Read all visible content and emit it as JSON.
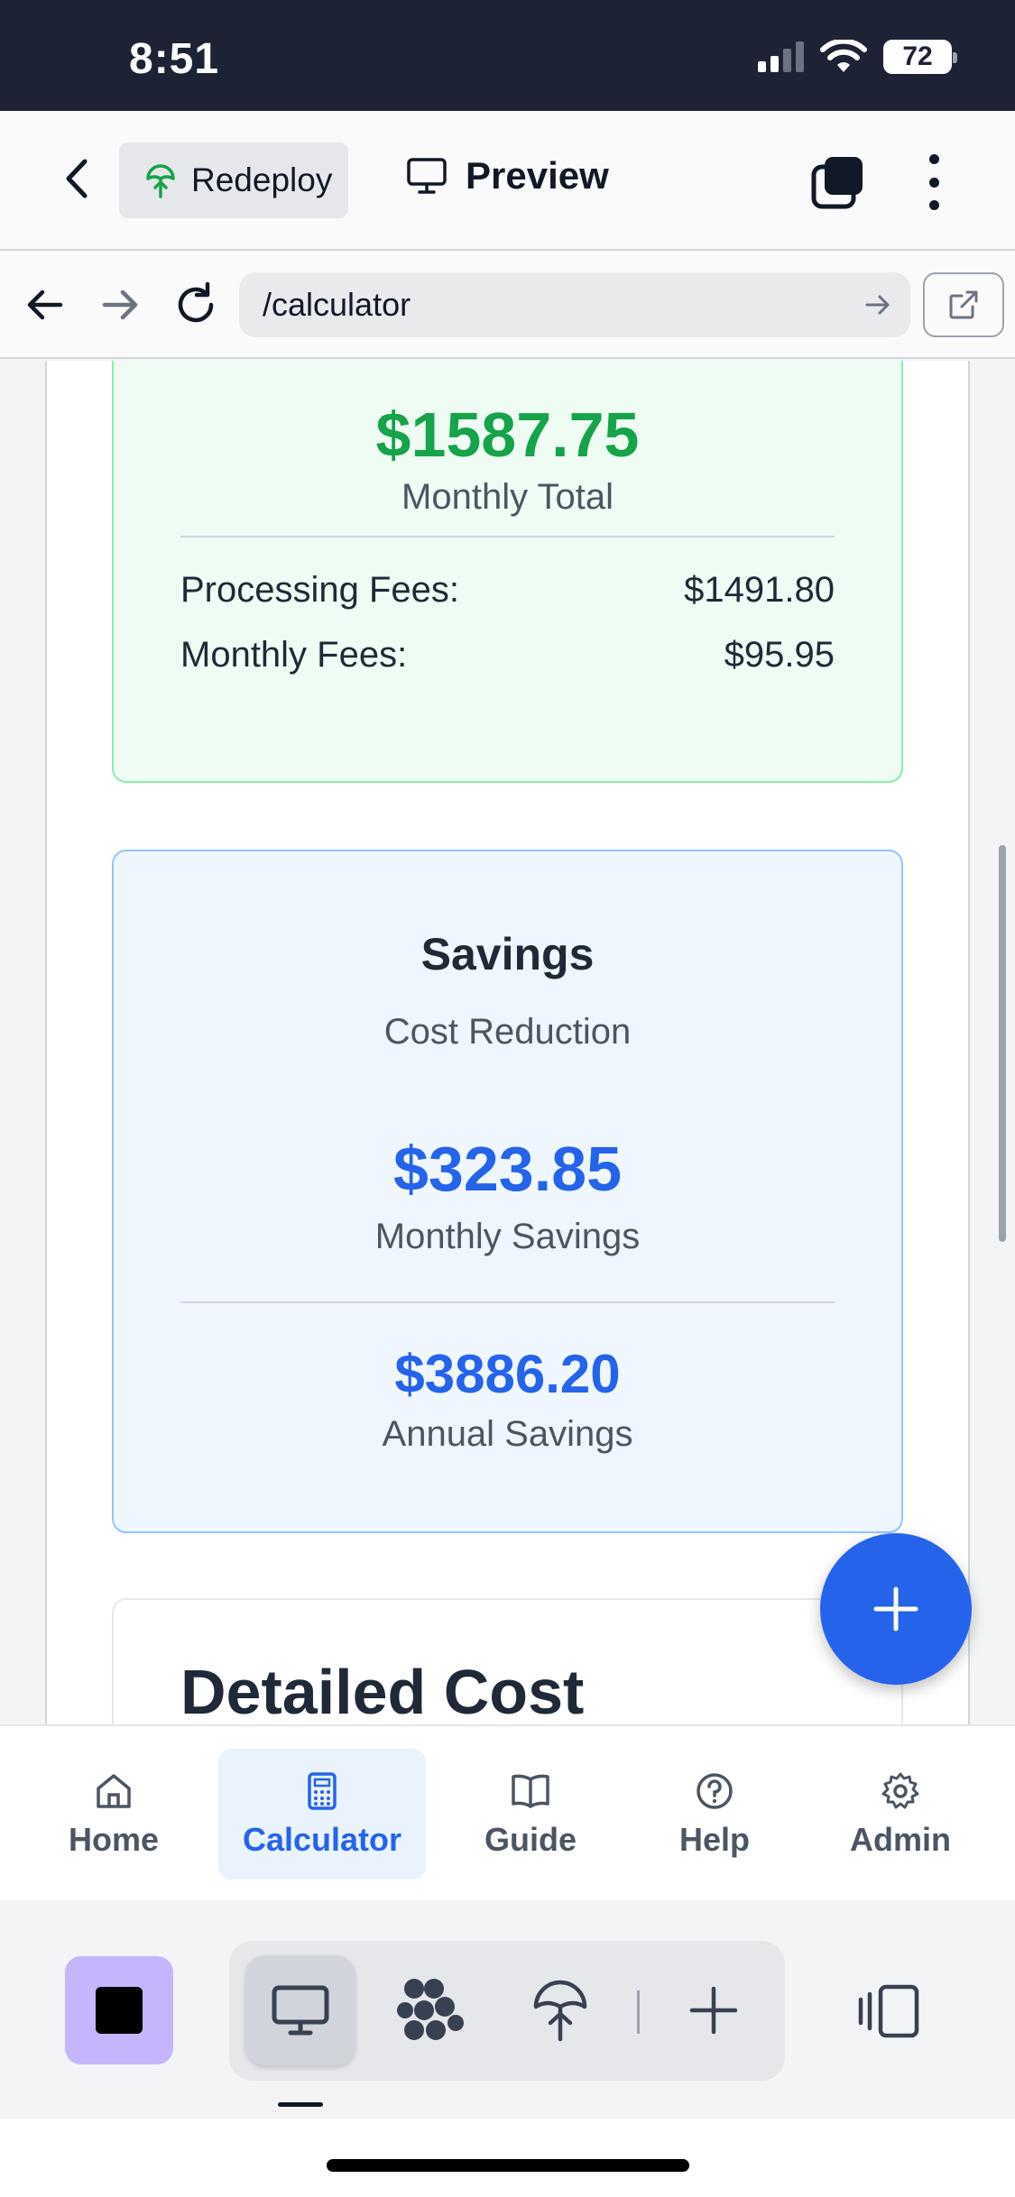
{
  "status_bar": {
    "time": "8:51",
    "battery": "72"
  },
  "header": {
    "redeploy_label": "Redeploy",
    "preview_label": "Preview"
  },
  "browser": {
    "url": "/calculator"
  },
  "total_card": {
    "amount": "$1587.75",
    "label": "Monthly Total",
    "rows": [
      {
        "label": "Processing Fees:",
        "value": "$1491.80"
      },
      {
        "label": "Monthly Fees:",
        "value": "$95.95"
      }
    ]
  },
  "savings_card": {
    "title": "Savings",
    "subtitle": "Cost Reduction",
    "monthly_amount": "$323.85",
    "monthly_label": "Monthly Savings",
    "annual_amount": "$3886.20",
    "annual_label": "Annual Savings"
  },
  "detail_card": {
    "title": "Detailed Cost"
  },
  "bottom_nav": {
    "items": [
      {
        "label": "Home",
        "icon": "home-icon"
      },
      {
        "label": "Calculator",
        "icon": "calculator-icon",
        "active": true
      },
      {
        "label": "Guide",
        "icon": "book-icon"
      },
      {
        "label": "Help",
        "icon": "help-circle-icon"
      },
      {
        "label": "Admin",
        "icon": "gear-icon"
      }
    ]
  },
  "colors": {
    "accent_blue": "#2563eb",
    "total_green": "#16a34a",
    "stop_button": "#c4b5fd"
  }
}
